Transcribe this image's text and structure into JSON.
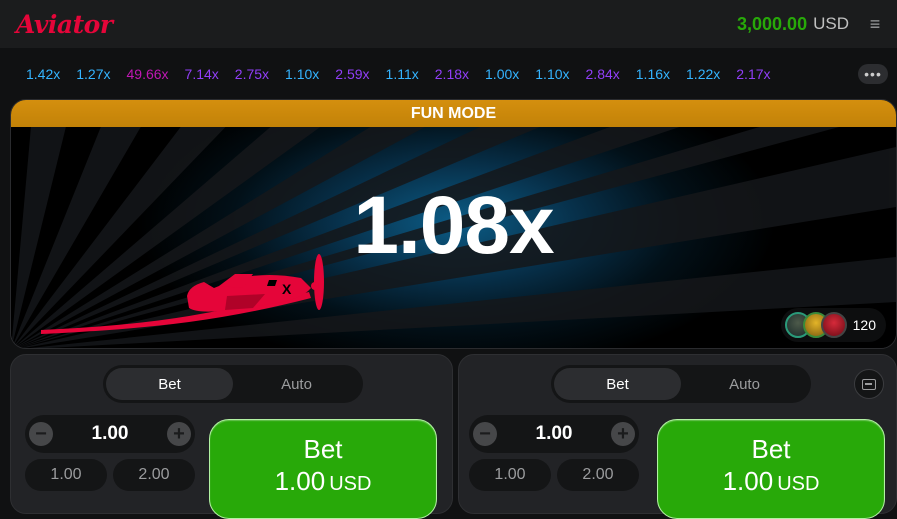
{
  "header": {
    "logo_text": "Aviator",
    "balance_amount": "3,000.00",
    "balance_currency": "USD",
    "menu_icon": "≡"
  },
  "history": {
    "items": [
      {
        "value": "1.42x",
        "color": "blue"
      },
      {
        "value": "1.27x",
        "color": "blue"
      },
      {
        "value": "49.66x",
        "color": "pink"
      },
      {
        "value": "7.14x",
        "color": "purple"
      },
      {
        "value": "2.75x",
        "color": "purple"
      },
      {
        "value": "1.10x",
        "color": "blue"
      },
      {
        "value": "2.59x",
        "color": "purple"
      },
      {
        "value": "1.11x",
        "color": "blue"
      },
      {
        "value": "2.18x",
        "color": "purple"
      },
      {
        "value": "1.00x",
        "color": "blue"
      },
      {
        "value": "1.10x",
        "color": "blue"
      },
      {
        "value": "2.84x",
        "color": "purple"
      },
      {
        "value": "1.16x",
        "color": "blue"
      },
      {
        "value": "1.22x",
        "color": "blue"
      },
      {
        "value": "2.17x",
        "color": "purple"
      }
    ],
    "more_icon": "•••"
  },
  "game": {
    "mode_banner": "FUN MODE",
    "multiplier": "1.08x",
    "player_count": "120",
    "plane_color": "#e50539"
  },
  "panels": [
    {
      "tabs": [
        "Bet",
        "Auto"
      ],
      "active_tab": "Bet",
      "amount": "1.00",
      "minus": "−",
      "plus": "+",
      "quick": [
        "1.00",
        "2.00"
      ],
      "bet_label": "Bet",
      "bet_amount": "1.00",
      "bet_currency": "USD"
    },
    {
      "tabs": [
        "Bet",
        "Auto"
      ],
      "active_tab": "Bet",
      "amount": "1.00",
      "minus": "−",
      "plus": "+",
      "quick": [
        "1.00",
        "2.00"
      ],
      "bet_label": "Bet",
      "bet_amount": "1.00",
      "bet_currency": "USD"
    }
  ],
  "colors": {
    "brand_red": "#e50539",
    "balance_green": "#28a909",
    "bet_green": "#28a909",
    "fun_mode_orange": "#d48f0e",
    "history_blue": "#34b4ff",
    "history_purple": "#913ef8",
    "history_pink": "#c017b4"
  }
}
